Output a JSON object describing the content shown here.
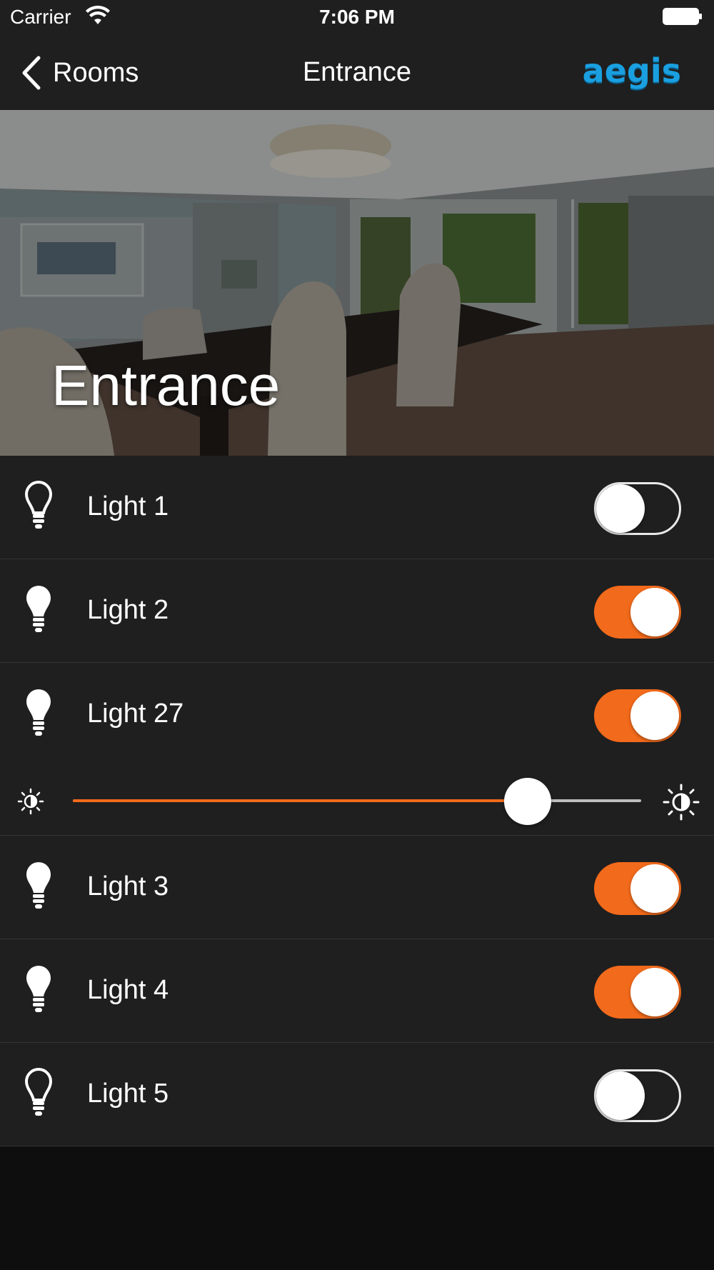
{
  "status_bar": {
    "carrier": "Carrier",
    "time": "7:06 PM"
  },
  "navbar": {
    "back_label": "Rooms",
    "title": "Entrance",
    "logo_text": "aegis"
  },
  "hero": {
    "title": "Entrance"
  },
  "lights": [
    {
      "label": "Light 1",
      "on": false,
      "icon": "bulb-outline-icon"
    },
    {
      "label": "Light 2",
      "on": true,
      "icon": "bulb-filled-icon"
    },
    {
      "label": "Light 27",
      "on": true,
      "icon": "bulb-filled-icon",
      "brightness": 0.8
    },
    {
      "label": "Light 3",
      "on": true,
      "icon": "bulb-filled-icon"
    },
    {
      "label": "Light 4",
      "on": true,
      "icon": "bulb-filled-icon"
    },
    {
      "label": "Light 5",
      "on": false,
      "icon": "bulb-outline-icon"
    }
  ],
  "colors": {
    "accent": "#f26a1b",
    "background": "#1f1f1f",
    "logo": "#1aa0e0"
  }
}
